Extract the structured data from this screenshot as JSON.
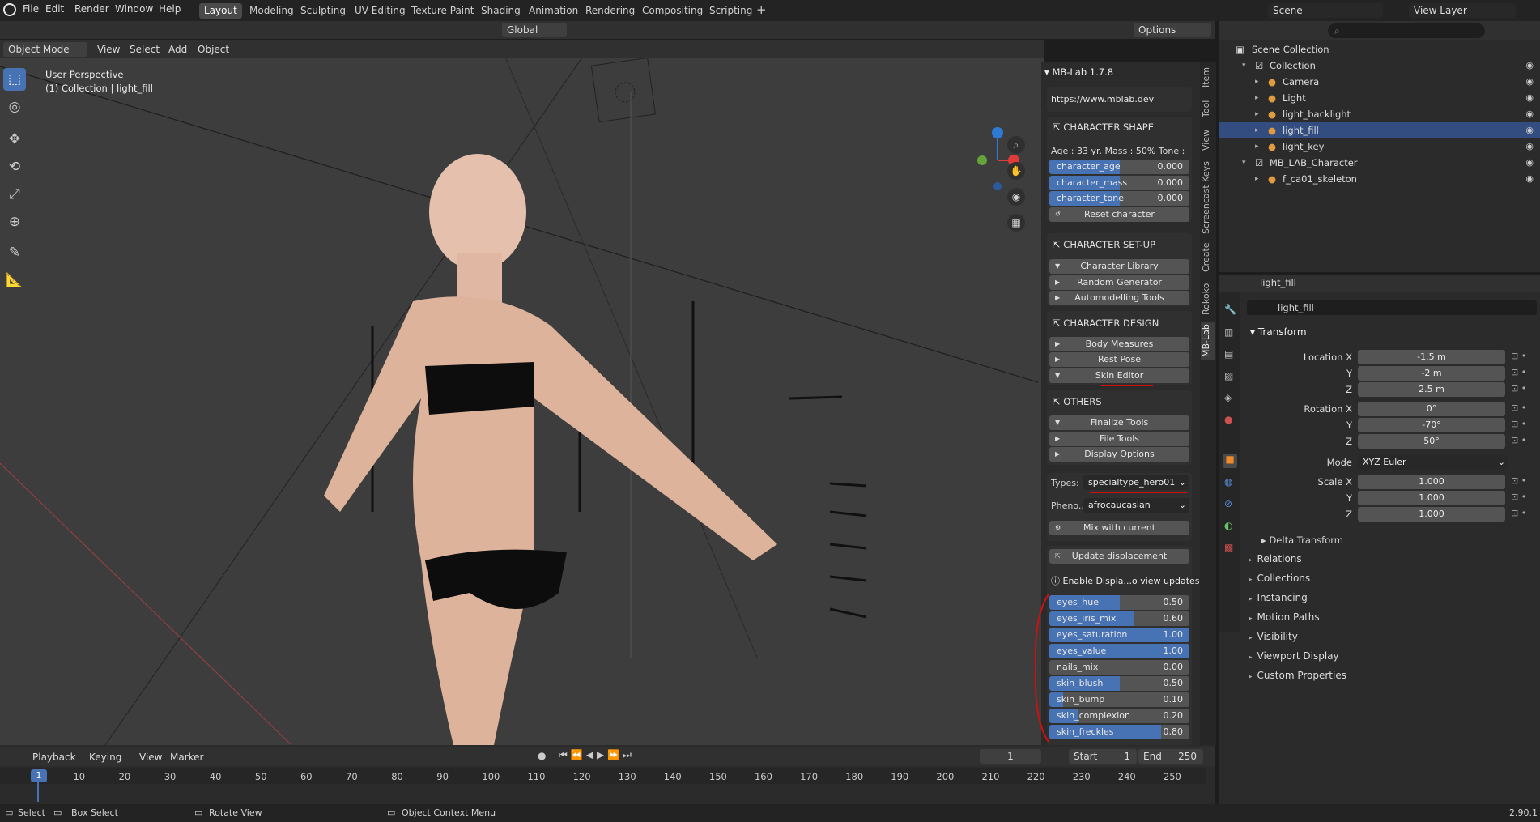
{
  "menu": {
    "items": [
      "File",
      "Edit",
      "Render",
      "Window",
      "Help"
    ]
  },
  "workspaces": [
    "Layout",
    "Modeling",
    "Sculpting",
    "UV Editing",
    "Texture Paint",
    "Shading",
    "Animation",
    "Rendering",
    "Compositing",
    "Scripting"
  ],
  "scene": {
    "label": "Scene",
    "view_layer": "View Layer"
  },
  "transform_header": {
    "orientation": "Global",
    "options": "Options"
  },
  "viewport_header": {
    "mode": "Object Mode",
    "view": "View",
    "select": "Select",
    "add": "Add",
    "object": "Object"
  },
  "viewport": {
    "overlay_line1": "User Perspective",
    "overlay_line2": "(1) Collection | light_fill"
  },
  "npanel": {
    "title": "MB-Lab 1.7.8",
    "url": "https://www.mblab.dev",
    "character_shape": "CHARACTER SHAPE",
    "stats": "Age : 33 yr.  Mass : 50%  Tone : ...",
    "shape_sliders": [
      {
        "name": "character_age",
        "value": "0.000",
        "fraction": 0.5
      },
      {
        "name": "character_mass",
        "value": "0.000",
        "fraction": 0.5
      },
      {
        "name": "character_tone",
        "value": "0.000",
        "fraction": 0.5
      }
    ],
    "reset": "Reset character",
    "setup": "CHARACTER SET-UP",
    "setup_items": [
      "Character Library",
      "Random Generator",
      "Automodelling Tools"
    ],
    "design": "CHARACTER DESIGN",
    "design_items": [
      "Body Measures",
      "Rest Pose",
      "Skin Editor"
    ],
    "others": "OTHERS",
    "others_items": [
      "Finalize Tools",
      "File Tools",
      "Display Options"
    ],
    "types_label": "Types:",
    "types_value": "specialtype_hero01",
    "pheno_label": "Pheno...",
    "pheno_value": "afrocaucasian",
    "mix": "Mix with current",
    "update_disp": "Update displacement",
    "enable_disp": "Enable Displa...o view updates",
    "skin_sliders": [
      {
        "name": "eyes_hue",
        "value": "0.50",
        "fraction": 0.5
      },
      {
        "name": "eyes_iris_mix",
        "value": "0.60",
        "fraction": 0.6
      },
      {
        "name": "eyes_saturation",
        "value": "1.00",
        "fraction": 1.0
      },
      {
        "name": "eyes_value",
        "value": "1.00",
        "fraction": 1.0
      },
      {
        "name": "nails_mix",
        "value": "0.00",
        "fraction": 0.0
      },
      {
        "name": "skin_blush",
        "value": "0.50",
        "fraction": 0.5
      },
      {
        "name": "skin_bump",
        "value": "0.10",
        "fraction": 0.1
      },
      {
        "name": "skin_complexion",
        "value": "0.20",
        "fraction": 0.2
      },
      {
        "name": "skin_freckles",
        "value": "0.80",
        "fraction": 0.8
      }
    ],
    "tabs": [
      "Item",
      "Tool",
      "View",
      "Screencast Keys",
      "Create",
      "Rokoko",
      "MB-Lab"
    ]
  },
  "outliner": {
    "root": "Scene Collection",
    "items": [
      {
        "label": "Collection",
        "indent": 1
      },
      {
        "label": "Camera",
        "indent": 2
      },
      {
        "label": "Light",
        "indent": 2
      },
      {
        "label": "light_backlight",
        "indent": 2
      },
      {
        "label": "light_fill",
        "indent": 2
      },
      {
        "label": "light_key",
        "indent": 2
      },
      {
        "label": "MB_LAB_Character",
        "indent": 1
      },
      {
        "label": "f_ca01_skeleton",
        "indent": 2
      }
    ]
  },
  "properties": {
    "object": "light_fill",
    "name_field": "light_fill",
    "transform": "Transform",
    "location": [
      {
        "label": "Location X",
        "value": "-1.5 m"
      },
      {
        "label": "Y",
        "value": "-2 m"
      },
      {
        "label": "Z",
        "value": "2.5 m"
      }
    ],
    "rotation": [
      {
        "label": "Rotation X",
        "value": "0°"
      },
      {
        "label": "Y",
        "value": "-70°"
      },
      {
        "label": "Z",
        "value": "50°"
      }
    ],
    "mode_label": "Mode",
    "mode_value": "XYZ Euler",
    "scale": [
      {
        "label": "Scale X",
        "value": "1.000"
      },
      {
        "label": "Y",
        "value": "1.000"
      },
      {
        "label": "Z",
        "value": "1.000"
      }
    ],
    "delta": "Delta Transform",
    "panels": [
      "Relations",
      "Collections",
      "Instancing",
      "Motion Paths",
      "Visibility",
      "Viewport Display",
      "Custom Properties"
    ]
  },
  "timeline": {
    "playback": "Playback",
    "keying": "Keying",
    "view": "View",
    "marker": "Marker",
    "current": "1",
    "start_label": "Start",
    "start": "1",
    "end_label": "End",
    "end": "250",
    "ticks": [
      "1",
      "10",
      "20",
      "30",
      "40",
      "50",
      "60",
      "70",
      "80",
      "90",
      "100",
      "110",
      "120",
      "130",
      "140",
      "150",
      "160",
      "170",
      "180",
      "190",
      "200",
      "210",
      "220",
      "230",
      "240",
      "250"
    ]
  },
  "status": {
    "select": "Select",
    "box": "Box Select",
    "rotate": "Rotate View",
    "context": "Object Context Menu",
    "version": "2.90.1"
  }
}
